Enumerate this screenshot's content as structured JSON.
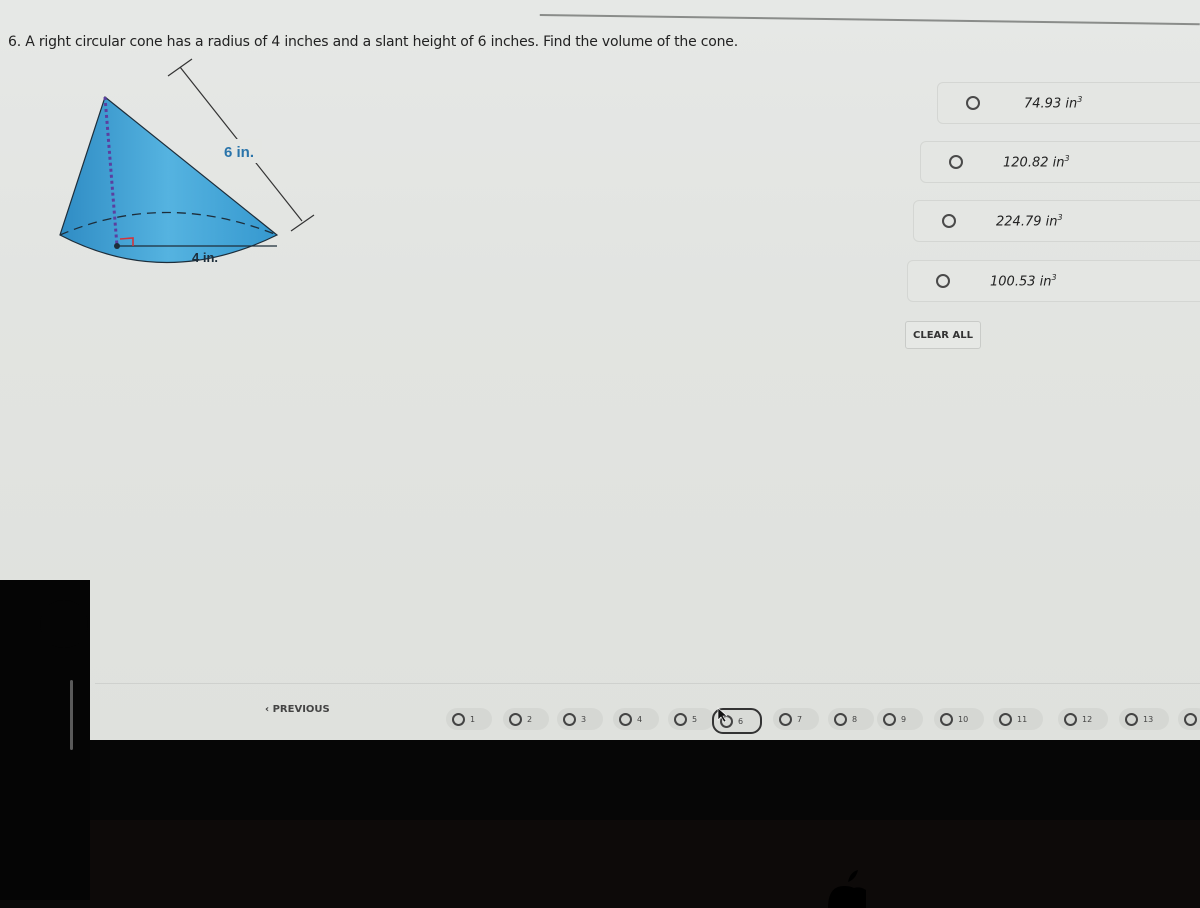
{
  "question": {
    "number": "6.",
    "text": "6. A right circular cone has a radius of 4 inches and a slant height of 6 inches.  Find the volume of the cone."
  },
  "figure": {
    "slant_label": "6 in.",
    "radius_label": "4 in.",
    "fill_color": "#3a9cd0"
  },
  "choices": [
    {
      "value": "74.93 in",
      "exp": "3",
      "selected": false
    },
    {
      "value": "120.82 in",
      "exp": "3",
      "selected": false
    },
    {
      "value": "224.79 in",
      "exp": "3",
      "selected": false
    },
    {
      "value": "100.53 in",
      "exp": "3",
      "selected": false
    }
  ],
  "clear_all_label": "CLEAR ALL",
  "navigation": {
    "previous_label": "‹  PREVIOUS",
    "current_question": "6",
    "questions": [
      "1",
      "2",
      "3",
      "4",
      "5",
      "6",
      "7",
      "8",
      "9",
      "10",
      "11",
      "12",
      "13"
    ]
  }
}
